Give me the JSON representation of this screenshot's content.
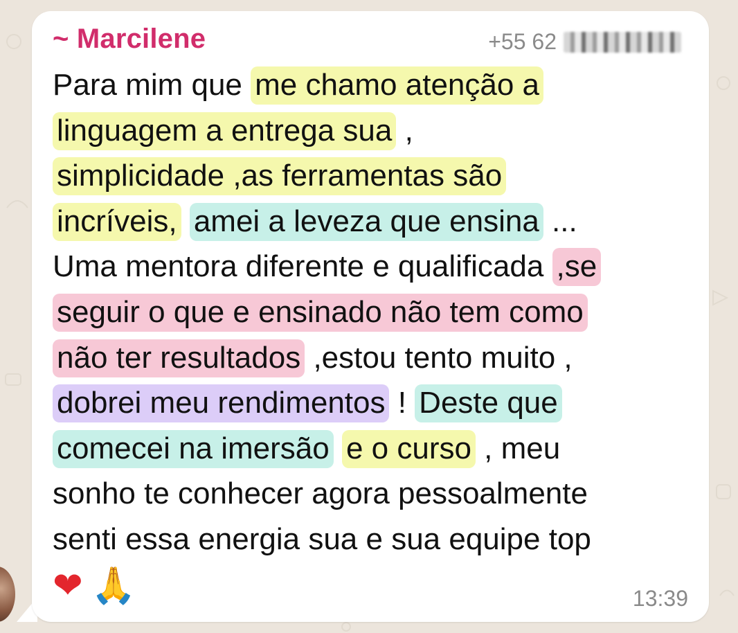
{
  "colors": {
    "background": "#ece5dc",
    "bubble": "#ffffff",
    "sender": "#d12d6b",
    "meta": "#8a8a8a",
    "highlight_yellow": "#f5f8ad",
    "highlight_teal": "#c7f0e8",
    "highlight_pink": "#f7c8d6",
    "highlight_purple": "#dccdf8"
  },
  "message": {
    "sender": "~ Marcilene",
    "phone_prefix": "+55 62",
    "time": "13:39",
    "lines": [
      [
        {
          "text": "Para mim que ",
          "hl": ""
        },
        {
          "text": "me chamo atenção a",
          "hl": "yellow"
        }
      ],
      [
        {
          "text": "linguagem  a entrega  sua",
          "hl": "yellow"
        },
        {
          "text": " ,",
          "hl": ""
        }
      ],
      [
        {
          "text": "simplicidade ,as ferramentas  são",
          "hl": "yellow"
        }
      ],
      [
        {
          "text": "incríveis,",
          "hl": "yellow"
        },
        {
          "text": " ",
          "hl": ""
        },
        {
          "text": "amei a leveza que ensina",
          "hl": "teal"
        },
        {
          "text": " ...",
          "hl": ""
        }
      ],
      [
        {
          "text": "Uma mentora diferente e qualificada ",
          "hl": ""
        },
        {
          "text": ",se",
          "hl": "pink"
        }
      ],
      [
        {
          "text": "seguir o que e ensinado não tem como",
          "hl": "pink"
        }
      ],
      [
        {
          "text": "não ter resultados",
          "hl": "pink"
        },
        {
          "text": " ,estou tento muito ,",
          "hl": ""
        }
      ],
      [
        {
          "text": "dobrei meu rendimentos",
          "hl": "purple"
        },
        {
          "text": " ! ",
          "hl": ""
        },
        {
          "text": "Deste que",
          "hl": "teal"
        }
      ],
      [
        {
          "text": "comecei na imersão",
          "hl": "teal"
        },
        {
          "text": " ",
          "hl": ""
        },
        {
          "text": "e o curso",
          "hl": "yellow"
        },
        {
          "text": " , meu",
          "hl": ""
        }
      ],
      [
        {
          "text": "sonho te conhecer agora pessoalmente",
          "hl": ""
        }
      ],
      [
        {
          "text": "senti essa energia sua e sua equipe top",
          "hl": ""
        }
      ]
    ],
    "emojis": [
      {
        "icon": "heart-icon",
        "glyph": "❤"
      },
      {
        "icon": "praying-hands-icon",
        "glyph": "🙏"
      }
    ]
  }
}
